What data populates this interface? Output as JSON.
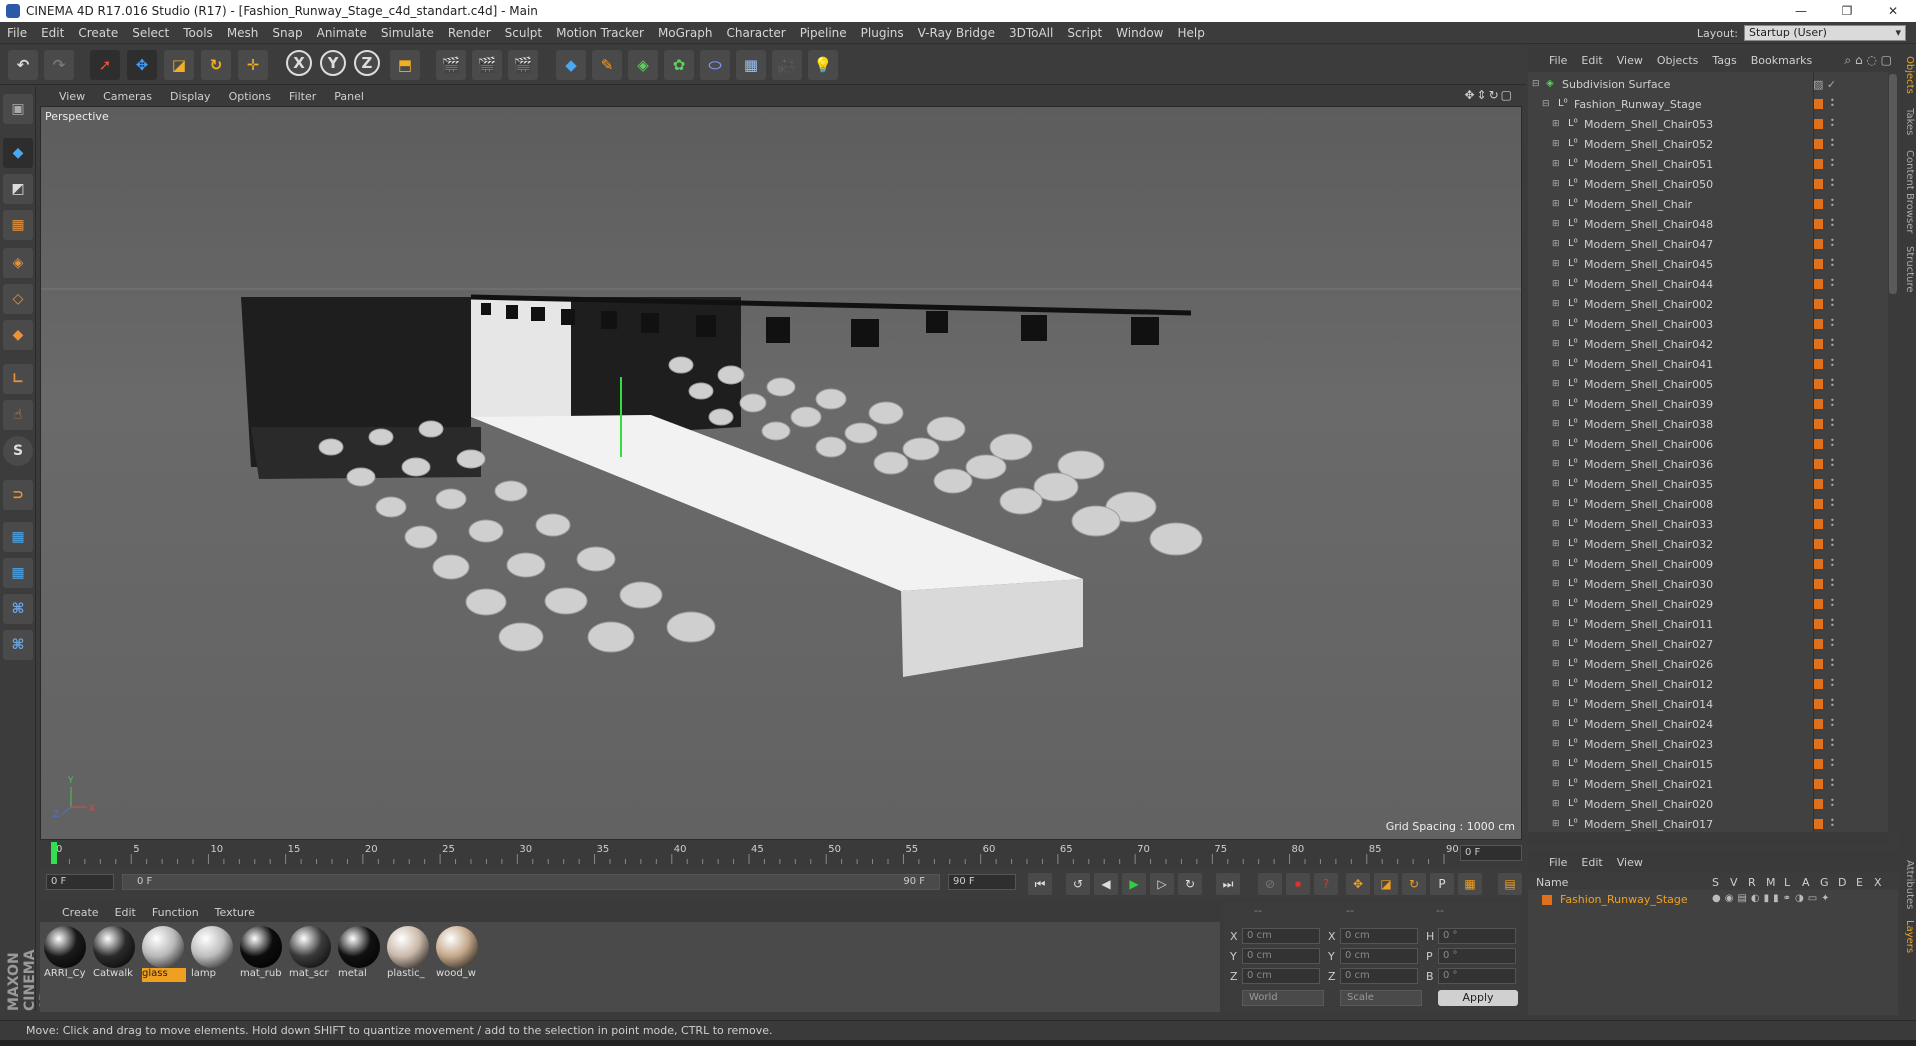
{
  "window": {
    "title": "CINEMA 4D R17.016 Studio (R17) - [Fashion_Runway_Stage_c4d_standart.c4d] - Main",
    "controls": [
      "—",
      "❐",
      "✕"
    ]
  },
  "menubar": {
    "items": [
      "File",
      "Edit",
      "Create",
      "Select",
      "Tools",
      "Mesh",
      "Snap",
      "Animate",
      "Simulate",
      "Render",
      "Sculpt",
      "Motion Tracker",
      "MoGraph",
      "Character",
      "Pipeline",
      "Plugins",
      "V-Ray Bridge",
      "3DToAll",
      "Script",
      "Window",
      "Help"
    ],
    "layout_label": "Layout:",
    "layout_value": "Startup (User)"
  },
  "toolbar": {
    "axis_x": "X",
    "axis_y": "Y",
    "axis_z": "Z"
  },
  "viewport": {
    "menu": [
      "View",
      "Cameras",
      "Display",
      "Options",
      "Filter",
      "Panel"
    ],
    "label": "Perspective",
    "grid_spacing": "Grid Spacing : 1000 cm",
    "axis_y": "Y",
    "axis_x": "X",
    "axis_z": "Z"
  },
  "timeline": {
    "ticks": [
      "0",
      "5",
      "10",
      "15",
      "20",
      "25",
      "30",
      "35",
      "40",
      "45",
      "50",
      "55",
      "60",
      "65",
      "70",
      "75",
      "80",
      "85",
      "90"
    ],
    "current_frame": "0 F",
    "start_field": "0 F",
    "range_start": "0 F",
    "range_end": "90 F",
    "end_field": "90 F"
  },
  "material_manager": {
    "menu": [
      "Create",
      "Edit",
      "Function",
      "Texture"
    ],
    "materials": [
      {
        "name": "ARRI_Cy",
        "color": "#1a1a1a"
      },
      {
        "name": "Catwalk",
        "color": "#2a2a2a"
      },
      {
        "name": "glass",
        "color": "#b8b8b8",
        "selected": true
      },
      {
        "name": "lamp",
        "color": "#bdbdbd"
      },
      {
        "name": "mat_rub",
        "color": "#0c0c0c"
      },
      {
        "name": "mat_scr",
        "color": "#3b3b3b"
      },
      {
        "name": "metal",
        "color": "#111111"
      },
      {
        "name": "plastic_",
        "color": "#c9b8a8"
      },
      {
        "name": "wood_w",
        "color": "#c4a88a"
      }
    ]
  },
  "coordinates": {
    "header": [
      "--",
      "--",
      "--"
    ],
    "rows": [
      {
        "l1": "X",
        "v1": "0 cm",
        "l2": "X",
        "v2": "0 cm",
        "l3": "H",
        "v3": "0 °"
      },
      {
        "l1": "Y",
        "v1": "0 cm",
        "l2": "Y",
        "v2": "0 cm",
        "l3": "P",
        "v3": "0 °"
      },
      {
        "l1": "Z",
        "v1": "0 cm",
        "l2": "Z",
        "v2": "0 cm",
        "l3": "B",
        "v3": "0 °"
      }
    ],
    "mode": "World",
    "type": "Scale",
    "apply": "Apply"
  },
  "status": "Move: Click and drag to move elements. Hold down SHIFT to quantize movement / add to the selection in point mode, CTRL to remove.",
  "object_manager": {
    "menu": [
      "File",
      "Edit",
      "View",
      "Objects",
      "Tags",
      "Bookmarks"
    ],
    "root": "Subdivision Surface",
    "group": "Fashion_Runway_Stage",
    "objects": [
      "Modern_Shell_Chair053",
      "Modern_Shell_Chair052",
      "Modern_Shell_Chair051",
      "Modern_Shell_Chair050",
      "Modern_Shell_Chair",
      "Modern_Shell_Chair048",
      "Modern_Shell_Chair047",
      "Modern_Shell_Chair045",
      "Modern_Shell_Chair044",
      "Modern_Shell_Chair002",
      "Modern_Shell_Chair003",
      "Modern_Shell_Chair042",
      "Modern_Shell_Chair041",
      "Modern_Shell_Chair005",
      "Modern_Shell_Chair039",
      "Modern_Shell_Chair038",
      "Modern_Shell_Chair006",
      "Modern_Shell_Chair036",
      "Modern_Shell_Chair035",
      "Modern_Shell_Chair008",
      "Modern_Shell_Chair033",
      "Modern_Shell_Chair032",
      "Modern_Shell_Chair009",
      "Modern_Shell_Chair030",
      "Modern_Shell_Chair029",
      "Modern_Shell_Chair011",
      "Modern_Shell_Chair027",
      "Modern_Shell_Chair026",
      "Modern_Shell_Chair012",
      "Modern_Shell_Chair014",
      "Modern_Shell_Chair024",
      "Modern_Shell_Chair023",
      "Modern_Shell_Chair015",
      "Modern_Shell_Chair021",
      "Modern_Shell_Chair020",
      "Modern_Shell_Chair017"
    ]
  },
  "layer_manager": {
    "menu": [
      "File",
      "Edit",
      "View"
    ],
    "name_col": "Name",
    "flags": [
      "S",
      "V",
      "R",
      "M",
      "L",
      "A",
      "G",
      "D",
      "E",
      "X"
    ],
    "layer": "Fashion_Runway_Stage"
  },
  "right_tabs": [
    "Objects",
    "Takes",
    "Content Browser",
    "Structure",
    "Attributes",
    "Layers"
  ],
  "brand": "MAXON CINEMA 4D",
  "colors": {
    "accent": "#e0701a",
    "selection": "#f0a020"
  }
}
